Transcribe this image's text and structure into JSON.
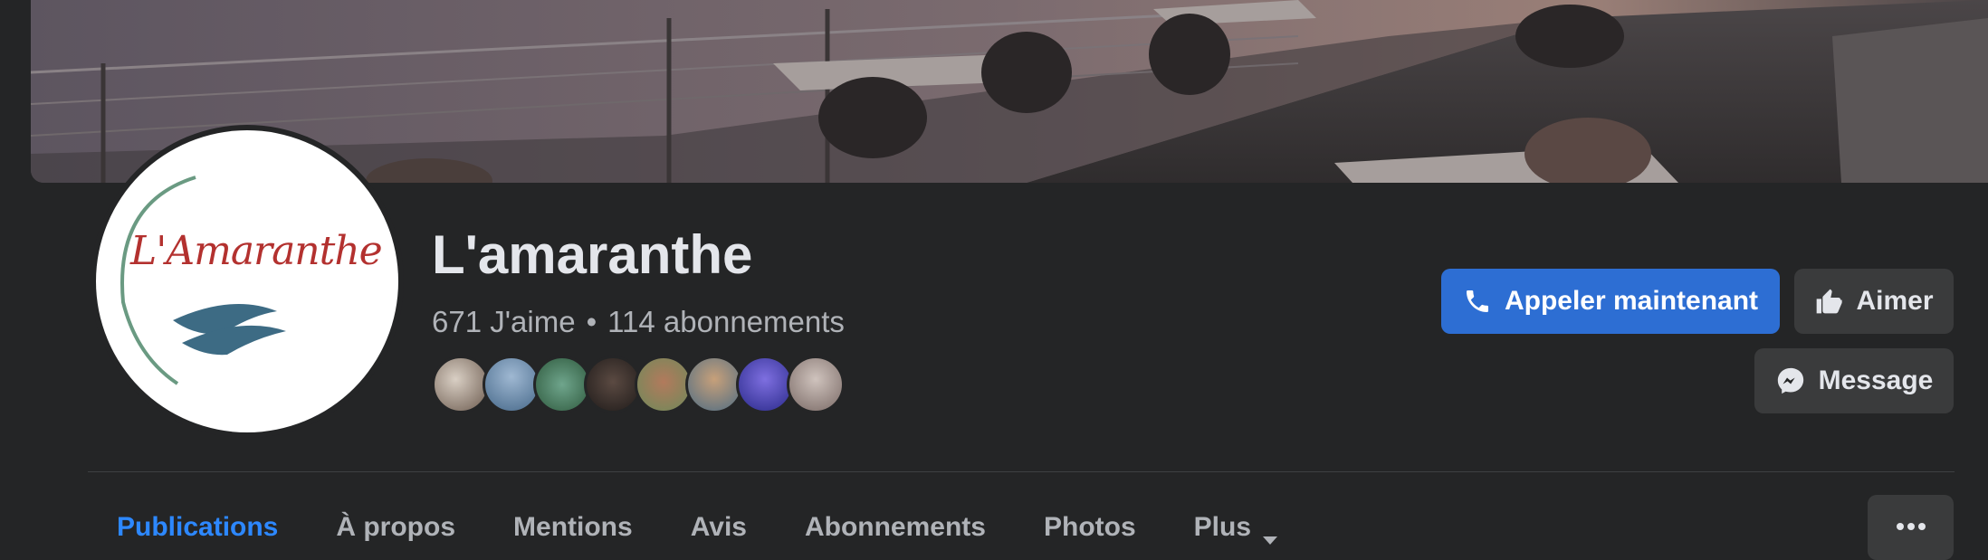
{
  "page": {
    "name": "L'amaranthe",
    "likes": "671 J'aime",
    "separator": "•",
    "followers": "114 abonnements",
    "logo_text": "L'Amaranthe"
  },
  "actions": {
    "call_label": "Appeler maintenant",
    "like_label": "Aimer",
    "message_label": "Message"
  },
  "tabs": [
    {
      "label": "Publications",
      "active": true
    },
    {
      "label": "À propos"
    },
    {
      "label": "Mentions"
    },
    {
      "label": "Avis"
    },
    {
      "label": "Abonnements"
    },
    {
      "label": "Photos"
    },
    {
      "label": "Plus"
    }
  ],
  "icons": {
    "call": "phone-icon",
    "like": "thumbs-up-icon",
    "message": "messenger-icon",
    "more": "more-options-icon",
    "dropdown": "caret-down-icon"
  },
  "colors": {
    "background": "#242526",
    "primary": "#2d6ed3",
    "active_tab": "#2d88ff",
    "secondary_button": "#3a3b3c",
    "logo_red": "#b3312f",
    "logo_blue": "#3d6b84",
    "logo_green": "#6a9a82"
  }
}
